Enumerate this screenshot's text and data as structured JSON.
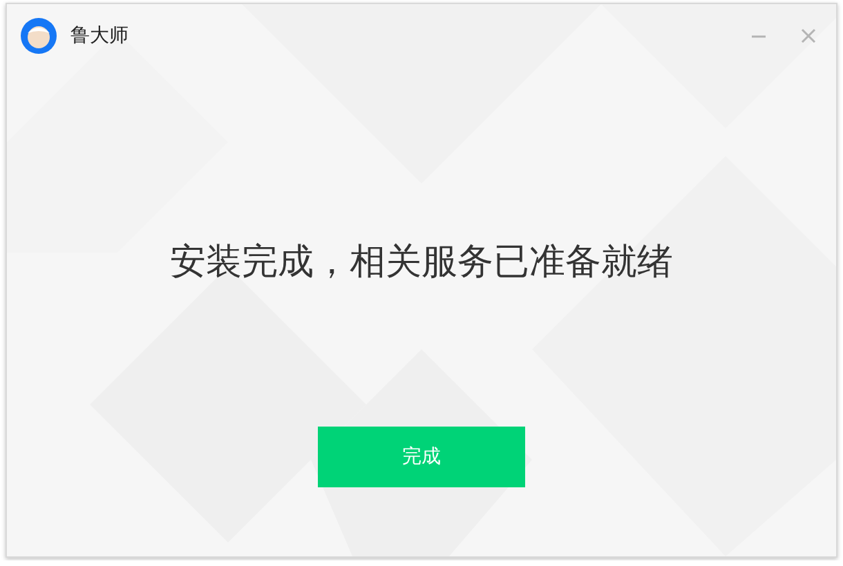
{
  "window": {
    "title": "鲁大师"
  },
  "message": "安装完成，相关服务已准备就绪",
  "buttons": [
    {
      "label": "完成",
      "kind": "primary"
    }
  ]
}
